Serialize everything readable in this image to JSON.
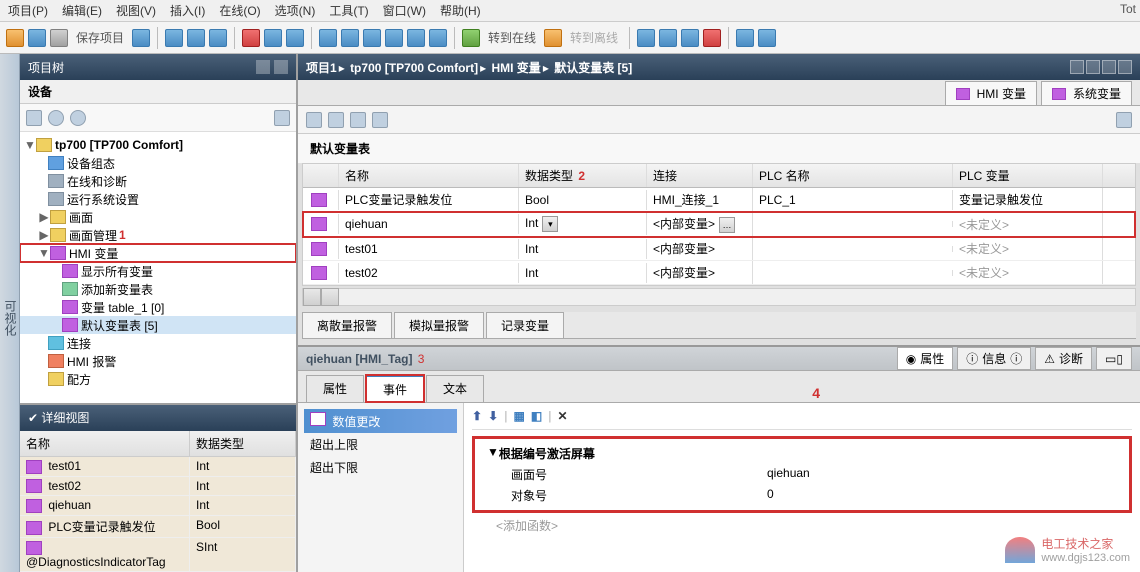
{
  "menubar": [
    "项目(P)",
    "编辑(E)",
    "视图(V)",
    "插入(I)",
    "在线(O)",
    "选项(N)",
    "工具(T)",
    "窗口(W)",
    "帮助(H)"
  ],
  "top_right": "Tot",
  "toolbar": {
    "save_label": "保存项目",
    "go_online": "转到在线",
    "go_offline": "转到离线"
  },
  "project_tree": {
    "title": "项目树",
    "device_tab": "设备",
    "root": "tp700 [TP700 Comfort]",
    "nodes": {
      "device_config": "设备组态",
      "online_diag": "在线和诊断",
      "runtime_settings": "运行系统设置",
      "screens": "画面",
      "screen_mgmt": "画面管理",
      "hmi_tags": "HMI 变量",
      "show_all": "显示所有变量",
      "add_table": "添加新变量表",
      "table1": "变量 table_1 [0]",
      "default_table": "默认变量表 [5]",
      "connections": "连接",
      "hmi_alarms": "HMI 报警",
      "recipes": "配方"
    },
    "annot1": "1"
  },
  "detail": {
    "title": "详细视图",
    "cols": {
      "name": "名称",
      "type": "数据类型"
    },
    "rows": [
      {
        "name": "test01",
        "type": "Int"
      },
      {
        "name": "test02",
        "type": "Int"
      },
      {
        "name": "qiehuan",
        "type": "Int"
      },
      {
        "name": "PLC变量记录触发位",
        "type": "Bool"
      },
      {
        "name": "@DiagnosticsIndicatorTag",
        "type": "SInt"
      }
    ]
  },
  "breadcrumb": [
    "项目1",
    "tp700 [TP700 Comfort]",
    "HMI 变量",
    "默认变量表 [5]"
  ],
  "right_tabs": {
    "hmi": "HMI 变量",
    "sys": "系统变量"
  },
  "table": {
    "title": "默认变量表",
    "annot2": "2",
    "cols": {
      "name": "名称",
      "type": "数据类型",
      "conn": "连接",
      "plc": "PLC 名称",
      "var": "PLC 变量"
    },
    "rows": [
      {
        "name": "PLC变量记录触发位",
        "type": "Bool",
        "conn": "HMI_连接_1",
        "plc": "PLC_1",
        "var": "变量记录触发位"
      },
      {
        "name": "qiehuan",
        "type": "Int",
        "conn": "<内部变量>",
        "plc": "",
        "var": "<未定义>",
        "hl": true
      },
      {
        "name": "test01",
        "type": "Int",
        "conn": "<内部变量>",
        "plc": "",
        "var": "<未定义>"
      },
      {
        "name": "test02",
        "type": "Int",
        "conn": "<内部变量>",
        "plc": "",
        "var": "<未定义>"
      }
    ]
  },
  "sub_tabs": [
    "离散量报警",
    "模拟量报警",
    "记录变量"
  ],
  "prop": {
    "title": "qiehuan [HMI_Tag]",
    "annot3": "3",
    "right_tabs": {
      "props": "属性",
      "info": "信息",
      "diag": "诊断"
    },
    "main_tabs": {
      "props": "属性",
      "events": "事件",
      "texts": "文本"
    },
    "events": {
      "value_change": "数值更改",
      "over_upper": "超出上限",
      "over_lower": "超出下限"
    },
    "func": {
      "annot4": "4",
      "header": "根据编号激活屏幕",
      "rows": [
        {
          "label": "画面号",
          "value": "qiehuan"
        },
        {
          "label": "对象号",
          "value": "0"
        }
      ],
      "add": "<添加函数>"
    }
  },
  "sidebar_label": "可视化",
  "watermark": {
    "t1": "电工技术之家",
    "t2": "www.dgjs123.com"
  }
}
